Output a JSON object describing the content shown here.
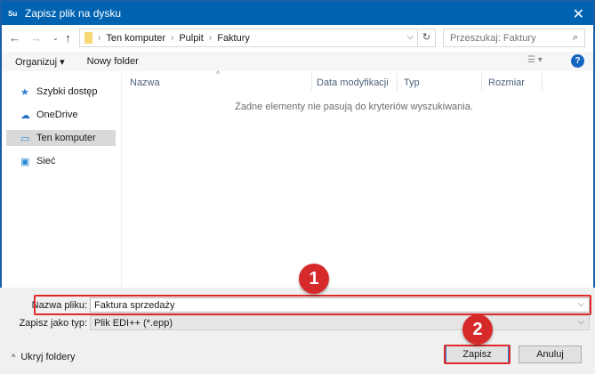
{
  "window": {
    "app_badge": "Su",
    "title": "Zapisz plik na dysku"
  },
  "nav": {
    "breadcrumb": [
      "Ten komputer",
      "Pulpit",
      "Faktury"
    ],
    "search_placeholder": "Przeszukaj: Faktury"
  },
  "toolbar": {
    "organize": "Organizuj ▾",
    "new_folder": "Nowy folder",
    "help": "?"
  },
  "sidebar": {
    "items": [
      {
        "label": "Szybki dostęp",
        "icon": "star-icon"
      },
      {
        "label": "OneDrive",
        "icon": "cloud-icon"
      },
      {
        "label": "Ten komputer",
        "icon": "computer-icon",
        "selected": true
      },
      {
        "label": "Sieć",
        "icon": "network-icon"
      }
    ]
  },
  "columns": [
    "Nazwa",
    "Data modyfikacji",
    "Typ",
    "Rozmiar"
  ],
  "empty_message": "Żadne elementy nie pasują do kryteriów wyszukiwania.",
  "form": {
    "filename_label": "Nazwa pliku:",
    "filename_value": "Faktura sprzedaży",
    "type_label": "Zapisz jako typ:",
    "type_value": "Plik EDI++ (*.epp)"
  },
  "footer": {
    "hide_folders": "Ukryj foldery",
    "save": "Zapisz",
    "cancel": "Anuluj"
  },
  "annotations": [
    "1",
    "2"
  ],
  "colors": {
    "titlebar": "#0063b1",
    "highlight": "#e02a2a"
  }
}
